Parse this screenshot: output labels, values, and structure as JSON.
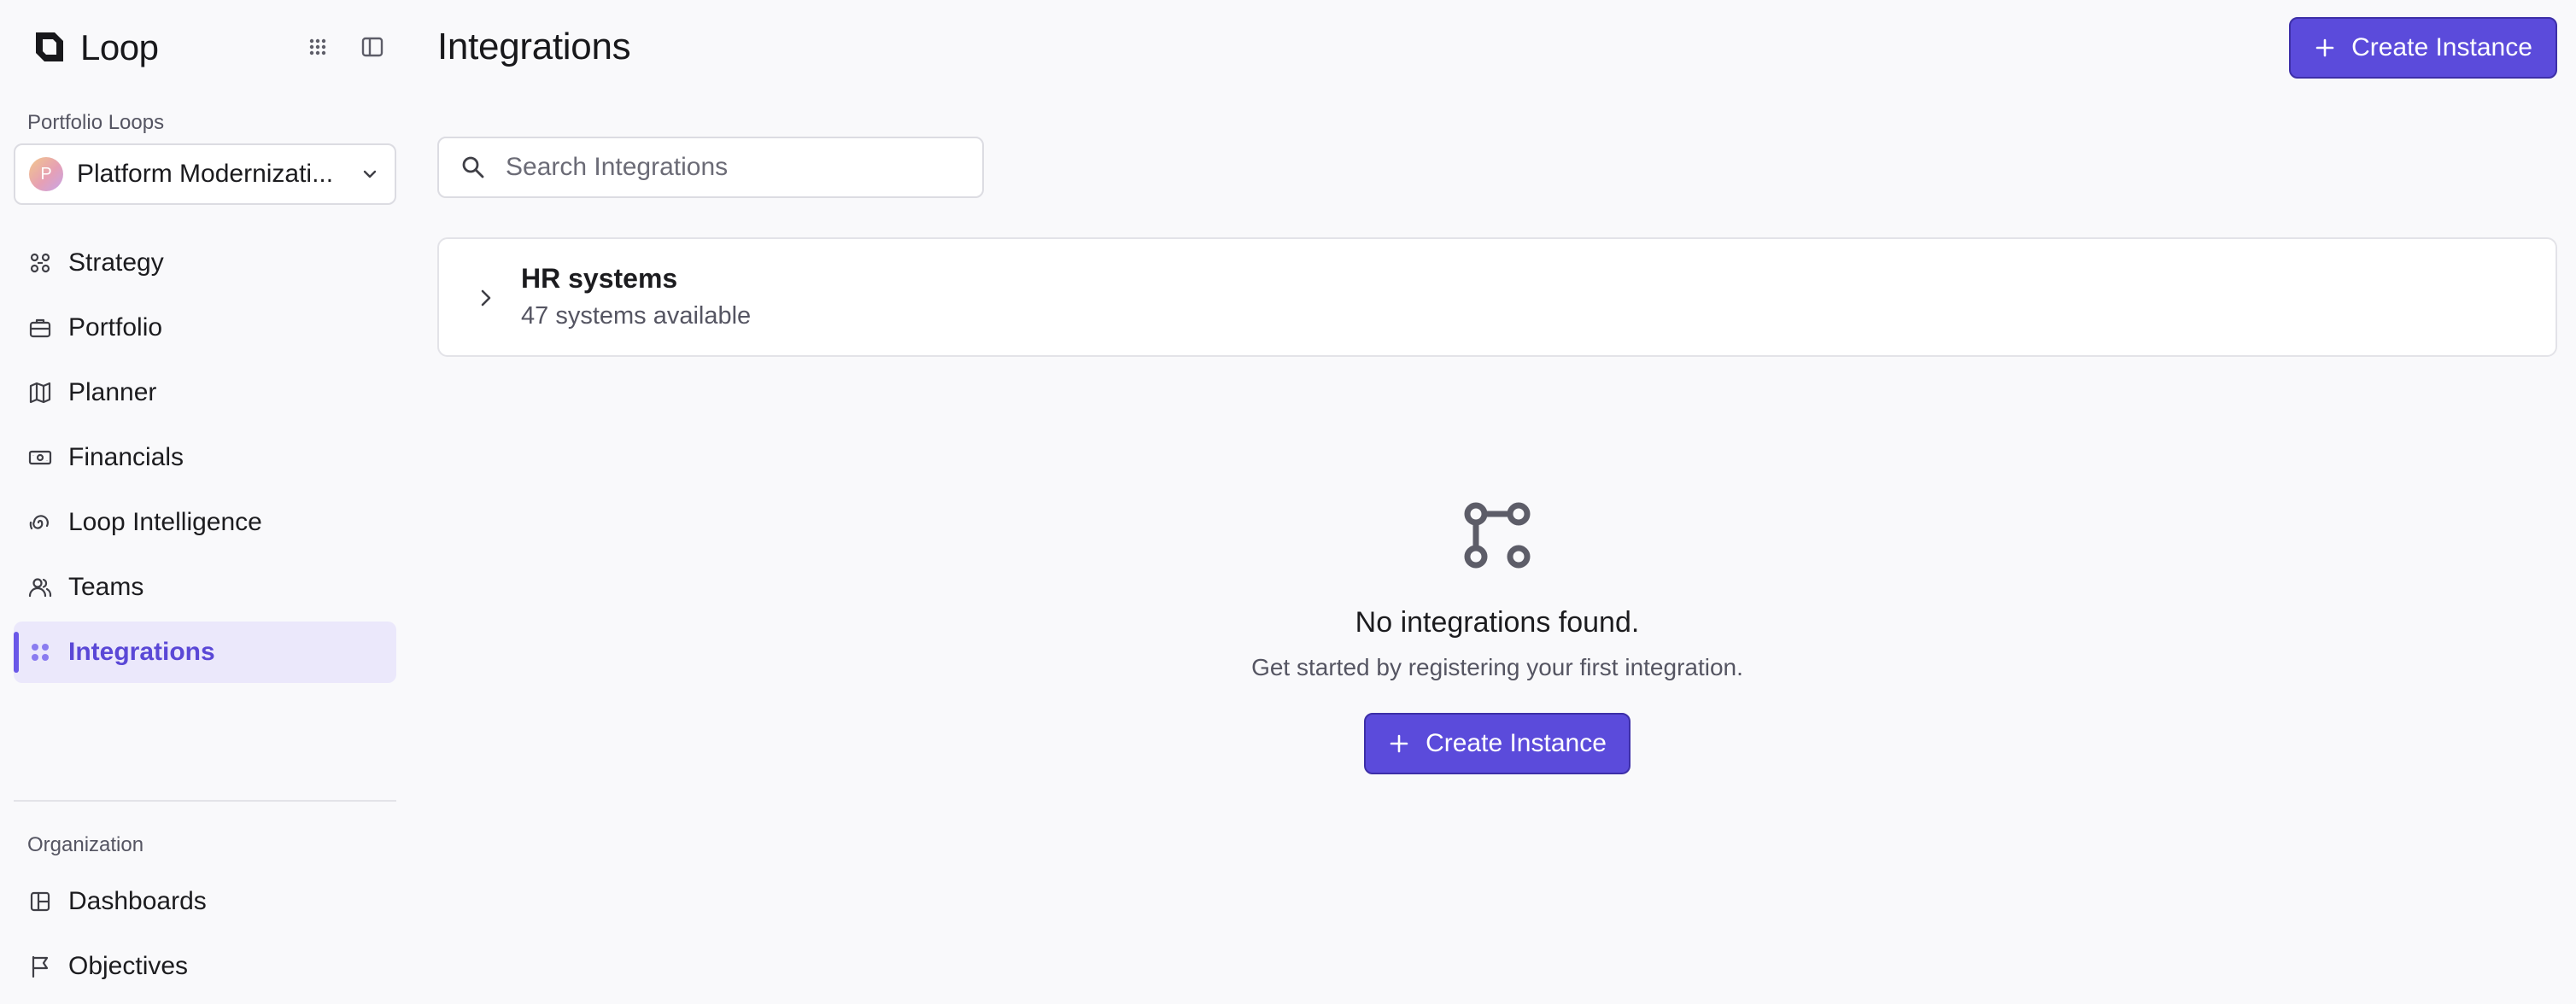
{
  "app": {
    "name": "Loop"
  },
  "sidebar": {
    "portfolio_label": "Portfolio Loops",
    "selected_loop": {
      "avatar_letter": "P",
      "name": "Platform Modernizati..."
    },
    "items": [
      {
        "label": "Strategy",
        "icon": "strategy-icon"
      },
      {
        "label": "Portfolio",
        "icon": "briefcase-icon"
      },
      {
        "label": "Planner",
        "icon": "map-icon"
      },
      {
        "label": "Financials",
        "icon": "banknote-icon"
      },
      {
        "label": "Loop Intelligence",
        "icon": "spiral-icon"
      },
      {
        "label": "Teams",
        "icon": "users-icon"
      },
      {
        "label": "Integrations",
        "icon": "grid-dots-icon",
        "active": true
      }
    ],
    "organization_label": "Organization",
    "org_items": [
      {
        "label": "Dashboards",
        "icon": "dashboard-icon"
      },
      {
        "label": "Objectives",
        "icon": "flag-icon"
      }
    ]
  },
  "header": {
    "title": "Integrations",
    "create_label": "Create Instance"
  },
  "search": {
    "placeholder": "Search Integrations",
    "value": ""
  },
  "groups": [
    {
      "title": "HR systems",
      "subtitle": "47 systems available"
    }
  ],
  "empty_state": {
    "title": "No integrations found.",
    "description": "Get started by registering your first integration.",
    "button_label": "Create Instance"
  },
  "colors": {
    "accent": "#5b4bdb",
    "accent_active_bg": "#ebe8fb",
    "accent_text": "#5a48d6",
    "background": "#f9f9fb"
  }
}
